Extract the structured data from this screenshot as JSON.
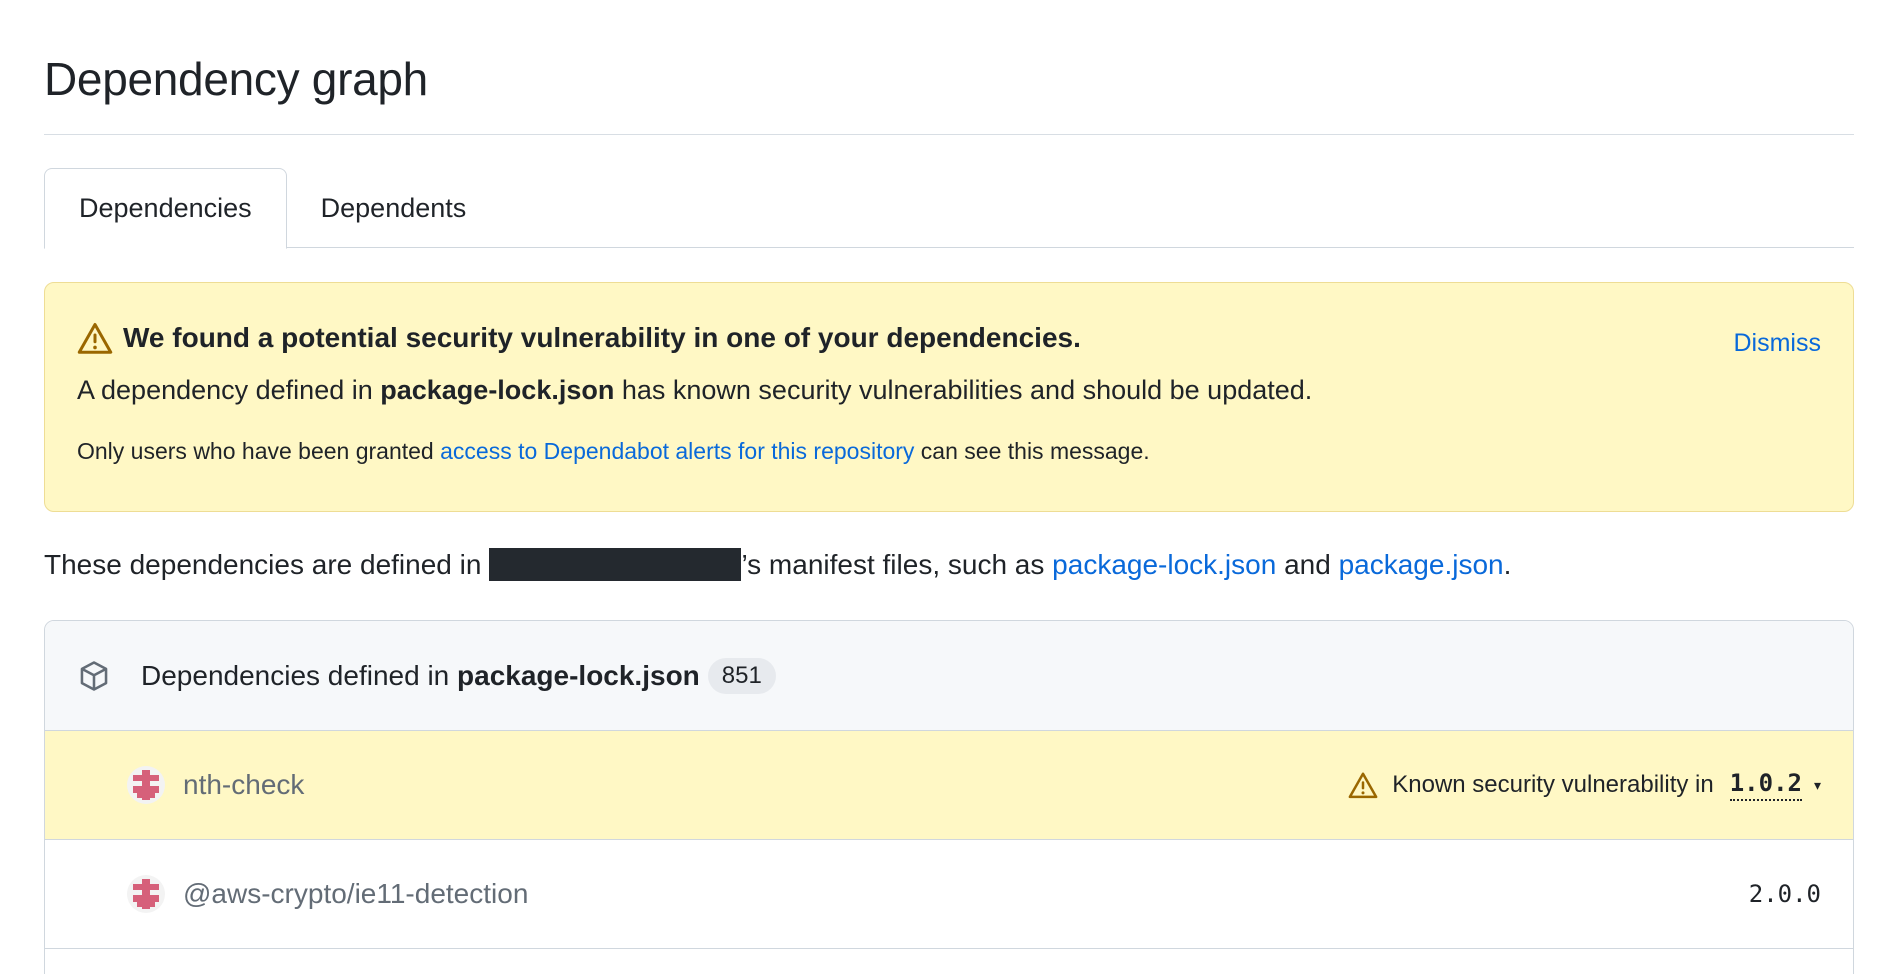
{
  "page": {
    "title": "Dependency graph"
  },
  "tabs": [
    {
      "label": "Dependencies",
      "selected": true
    },
    {
      "label": "Dependents",
      "selected": false
    }
  ],
  "alert": {
    "heading": "We found a potential security vulnerability in one of your dependencies.",
    "dismiss": "Dismiss",
    "body_prefix": "A dependency defined in ",
    "body_file": "package-lock.json",
    "body_suffix": " has known security vulnerabilities and should be updated.",
    "note_prefix": "Only users who have been granted ",
    "note_link": "access to Dependabot alerts for this repository",
    "note_suffix": " can see this message."
  },
  "manifest": {
    "prefix": "These dependencies are defined in",
    "possessive": "’s manifest files, such as ",
    "file1": "package-lock.json",
    "conjunction": " and ",
    "file2": "package.json",
    "end": "."
  },
  "dependencies_box": {
    "header_prefix": "Dependencies defined in ",
    "header_file": "package-lock.json",
    "count": "851",
    "rows": [
      {
        "name": "nth-check",
        "alert_text": "Known security vulnerability in",
        "version": "1.0.2"
      },
      {
        "name": "@aws-crypto/ie11-detection",
        "version": "2.0.0"
      }
    ]
  },
  "colors": {
    "accent": "#0969da",
    "alert_bg": "#fff8c5",
    "warning": "#9a6700",
    "avatar": "#d6607a"
  }
}
